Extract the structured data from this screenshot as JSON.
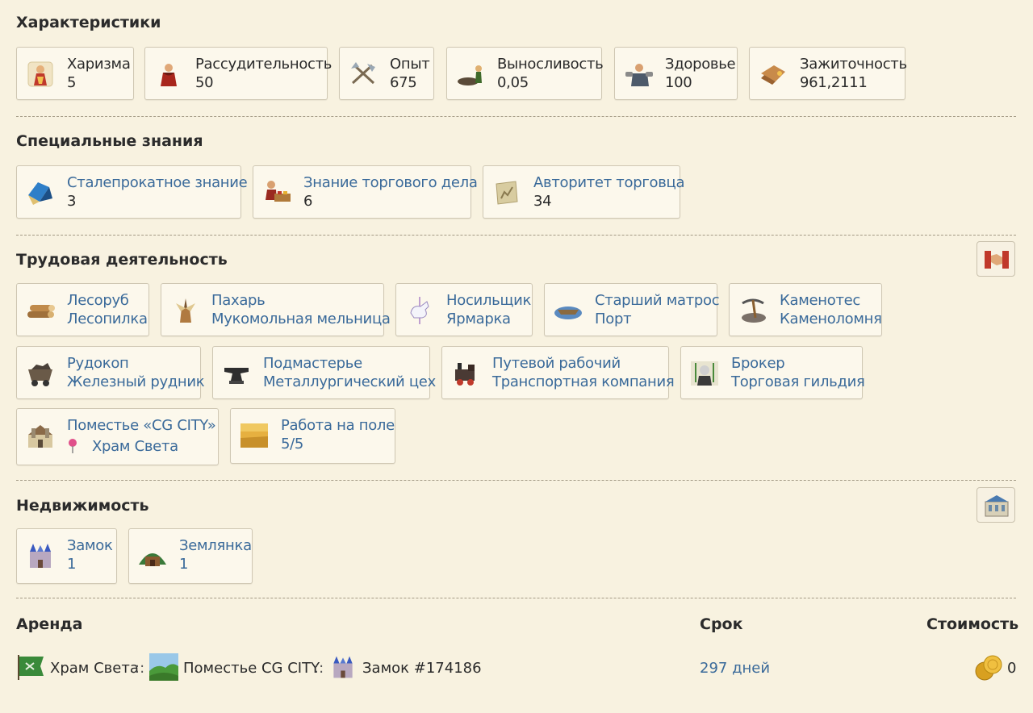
{
  "sections": {
    "characteristics": {
      "title": "Характеристики",
      "items": [
        {
          "label": "Харизма",
          "value": "5",
          "icon": "charisma-icon"
        },
        {
          "label": "Рассудительность",
          "value": "50",
          "icon": "prudence-icon"
        },
        {
          "label": "Опыт",
          "value": "675",
          "icon": "experience-icon"
        },
        {
          "label": "Выносливость",
          "value": "0,05",
          "icon": "endurance-icon"
        },
        {
          "label": "Здоровье",
          "value": "100",
          "icon": "health-icon"
        },
        {
          "label": "Зажиточность",
          "value": "961,2111",
          "icon": "wealth-icon"
        }
      ]
    },
    "knowledge": {
      "title": "Специальные знания",
      "items": [
        {
          "label": "Сталепрокатное знание",
          "value": "3",
          "icon": "steel-knowledge-icon"
        },
        {
          "label": "Знание торгового дела",
          "value": "6",
          "icon": "trade-knowledge-icon"
        },
        {
          "label": "Авторитет торговца",
          "value": "34",
          "icon": "merchant-authority-icon"
        }
      ]
    },
    "labor": {
      "title": "Трудовая деятельность",
      "items": [
        {
          "label": "Лесоруб",
          "value": "Лесопилка",
          "icon": "logs-icon"
        },
        {
          "label": "Пахарь",
          "value": "Мукомольная мельница",
          "icon": "mill-icon"
        },
        {
          "label": "Носильщик",
          "value": "Ярмарка",
          "icon": "carousel-horse-icon"
        },
        {
          "label": "Старший матрос",
          "value": "Порт",
          "icon": "boat-icon"
        },
        {
          "label": "Каменотес",
          "value": "Каменоломня",
          "icon": "pickaxe-icon"
        },
        {
          "label": "Рудокоп",
          "value": "Железный рудник",
          "icon": "mine-cart-icon"
        },
        {
          "label": "Подмастерье",
          "value": "Металлургический цех",
          "icon": "anvil-icon"
        },
        {
          "label": "Путевой рабочий",
          "value": "Транспортная компания",
          "icon": "locomotive-icon"
        },
        {
          "label": "Брокер",
          "value": "Торговая гильдия",
          "icon": "broker-icon"
        },
        {
          "label": "Поместье «CG CITY»",
          "value": "Храм Света",
          "icon": "estate-icon"
        },
        {
          "label": "Работа на поле",
          "value": "5/5",
          "icon": "wheat-field-icon"
        }
      ]
    },
    "realty": {
      "title": "Недвижимость",
      "items": [
        {
          "label": "Замок",
          "value": "1",
          "icon": "castle-icon"
        },
        {
          "label": "Землянка",
          "value": "1",
          "icon": "dugout-icon"
        }
      ]
    },
    "rent": {
      "title": "Аренда",
      "col_term": "Срок",
      "col_cost": "Стоимость",
      "row": {
        "part1": "Храм Света",
        "sep1": "::",
        "part2": "Поместье CG CITY",
        "sep2": "::",
        "part3": "Замок #174186",
        "term": "297 дней",
        "cost": "0"
      }
    }
  },
  "colors": {
    "background": "#f8f2e0",
    "link": "#3a6a9a",
    "card_border": "#cfc7b3",
    "divider": "#a39a85"
  }
}
